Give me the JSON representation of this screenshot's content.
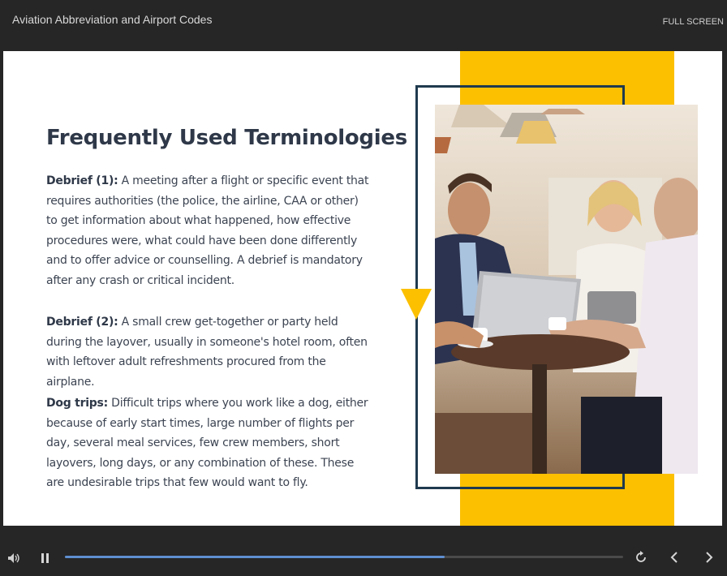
{
  "header": {
    "title": "Aviation Abbreviation and Airport Codes",
    "fullscreen_label": "FULL SCREEN"
  },
  "slide": {
    "heading": "Frequently Used Terminologies",
    "items": [
      {
        "term": "Debrief (1):",
        "definition": " A meeting after a flight or specific event that requires authorities (the police, the airline, CAA or other) to get information about what happened, how effective procedures were, what could have been done differently and to offer advice or counselling. A debrief is mandatory after any crash or critical incident."
      },
      {
        "term": "Debrief (2):",
        "definition": " A small crew get-together or party held during the layover, usually in someone's hotel room, often with leftover adult refreshments procured from the airplane."
      },
      {
        "term": "Dog trips:",
        "definition": " Difficult trips where you work like a dog, either because of early start times, large number of flights per day, several meal services, few crew members, short layovers, long days, or any combination of these. These are undesirable trips that few would want to fly."
      }
    ],
    "colors": {
      "accent": "#fcc000",
      "frame": "#1f3a4f",
      "heading": "#2e3848"
    }
  },
  "player": {
    "progress": 0.68,
    "icons": [
      "volume-icon",
      "pause-icon",
      "replay-icon",
      "prev-icon",
      "next-icon"
    ]
  }
}
